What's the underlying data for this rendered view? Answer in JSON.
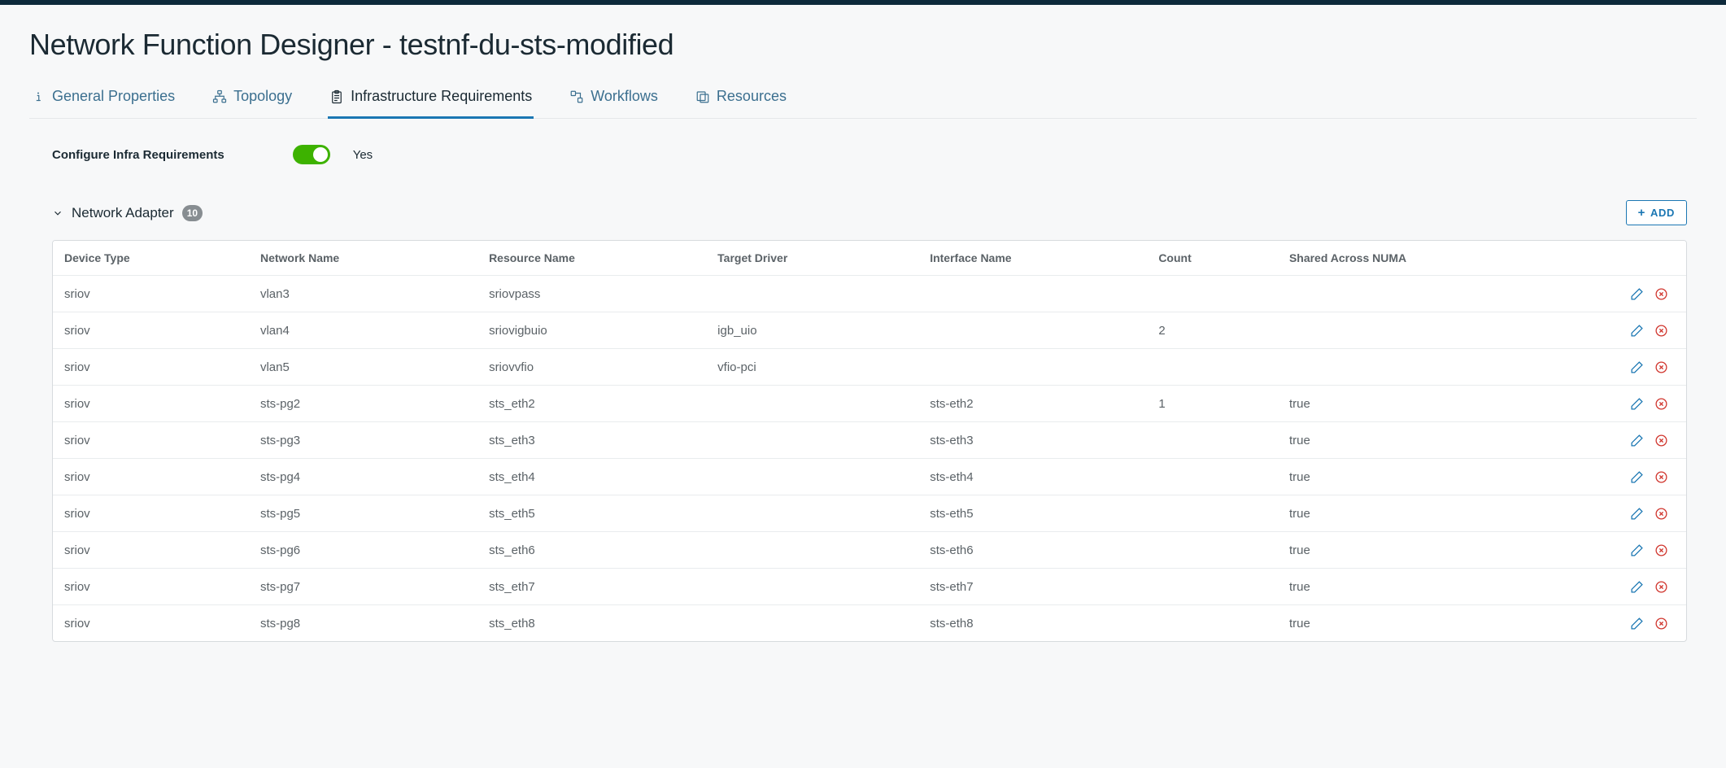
{
  "page": {
    "title": "Network Function Designer - testnf-du-sts-modified"
  },
  "tabs": {
    "general": {
      "label": "General Properties"
    },
    "topology": {
      "label": "Topology"
    },
    "infra": {
      "label": "Infrastructure Requirements"
    },
    "workflows": {
      "label": "Workflows"
    },
    "resources": {
      "label": "Resources"
    }
  },
  "config": {
    "label": "Configure Infra Requirements",
    "value_text": "Yes"
  },
  "section": {
    "title": "Network Adapter",
    "badge": "10",
    "add_label": "ADD"
  },
  "columns": {
    "device_type": "Device Type",
    "network_name": "Network Name",
    "resource_name": "Resource Name",
    "target_driver": "Target Driver",
    "interface_name": "Interface Name",
    "count": "Count",
    "shared_numa": "Shared Across NUMA"
  },
  "rows": [
    {
      "device_type": "sriov",
      "network_name": "vlan3",
      "resource_name": "sriovpass",
      "target_driver": "",
      "interface_name": "",
      "count": "",
      "shared_numa": ""
    },
    {
      "device_type": "sriov",
      "network_name": "vlan4",
      "resource_name": "sriovigbuio",
      "target_driver": "igb_uio",
      "interface_name": "",
      "count": "2",
      "shared_numa": ""
    },
    {
      "device_type": "sriov",
      "network_name": "vlan5",
      "resource_name": "sriovvfio",
      "target_driver": "vfio-pci",
      "interface_name": "",
      "count": "",
      "shared_numa": ""
    },
    {
      "device_type": "sriov",
      "network_name": "sts-pg2",
      "resource_name": "sts_eth2",
      "target_driver": "",
      "interface_name": "sts-eth2",
      "count": "1",
      "shared_numa": "true"
    },
    {
      "device_type": "sriov",
      "network_name": "sts-pg3",
      "resource_name": "sts_eth3",
      "target_driver": "",
      "interface_name": "sts-eth3",
      "count": "",
      "shared_numa": "true"
    },
    {
      "device_type": "sriov",
      "network_name": "sts-pg4",
      "resource_name": "sts_eth4",
      "target_driver": "",
      "interface_name": "sts-eth4",
      "count": "",
      "shared_numa": "true"
    },
    {
      "device_type": "sriov",
      "network_name": "sts-pg5",
      "resource_name": "sts_eth5",
      "target_driver": "",
      "interface_name": "sts-eth5",
      "count": "",
      "shared_numa": "true"
    },
    {
      "device_type": "sriov",
      "network_name": "sts-pg6",
      "resource_name": "sts_eth6",
      "target_driver": "",
      "interface_name": "sts-eth6",
      "count": "",
      "shared_numa": "true"
    },
    {
      "device_type": "sriov",
      "network_name": "sts-pg7",
      "resource_name": "sts_eth7",
      "target_driver": "",
      "interface_name": "sts-eth7",
      "count": "",
      "shared_numa": "true"
    },
    {
      "device_type": "sriov",
      "network_name": "sts-pg8",
      "resource_name": "sts_eth8",
      "target_driver": "",
      "interface_name": "sts-eth8",
      "count": "",
      "shared_numa": "true"
    }
  ]
}
